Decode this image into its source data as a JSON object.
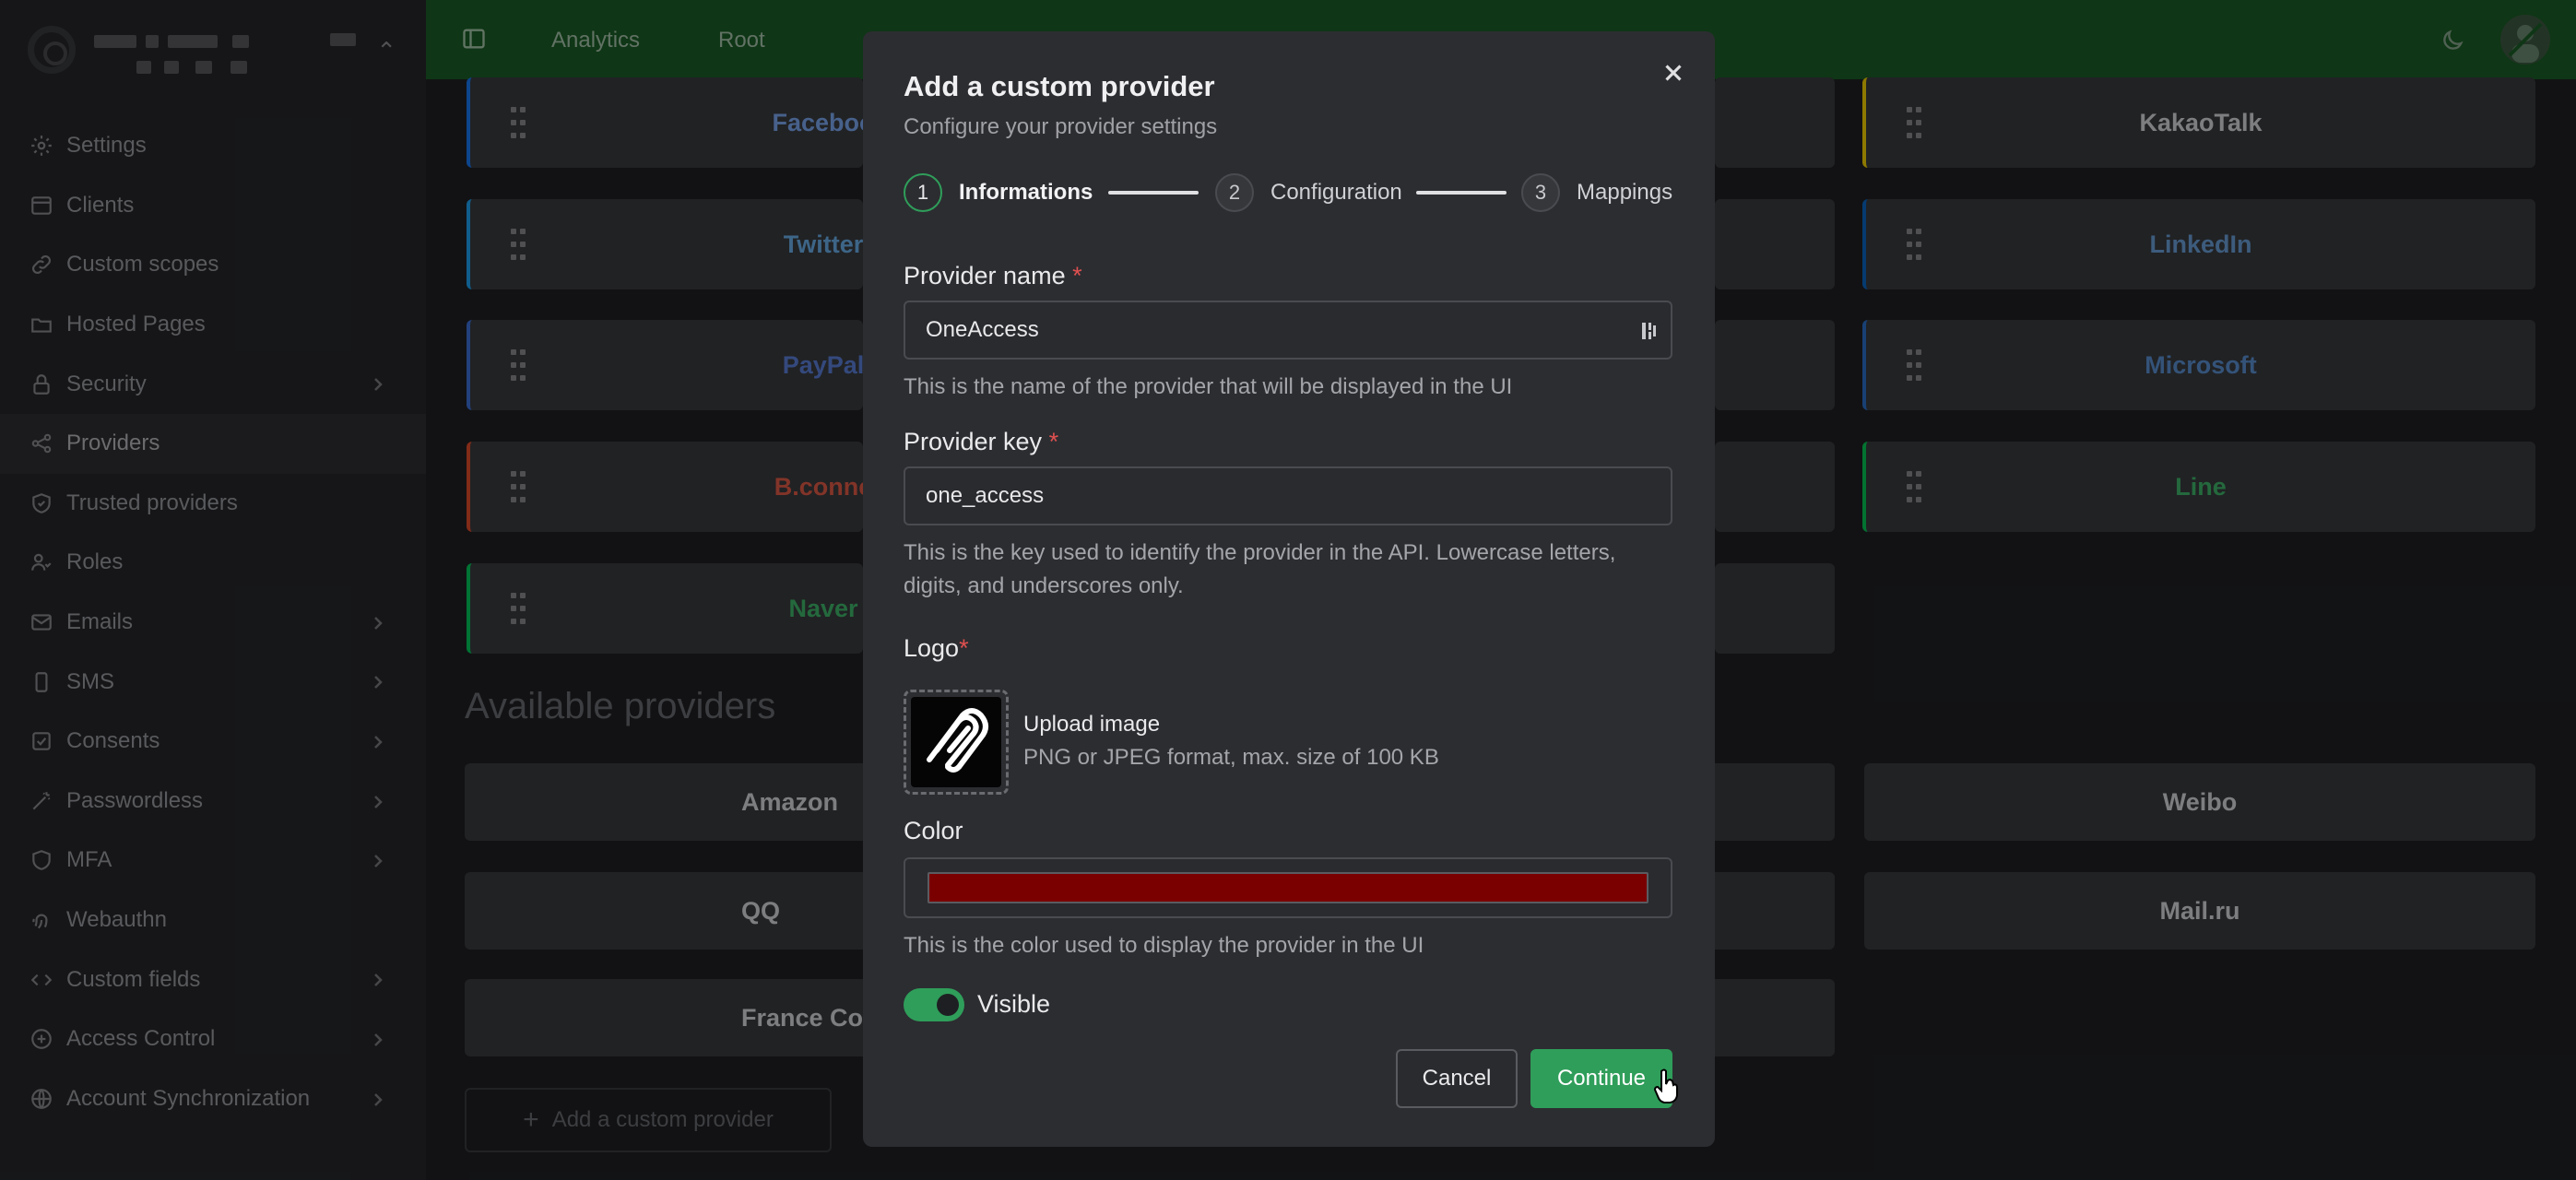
{
  "sidebar": {
    "items": [
      {
        "label": "Settings",
        "icon": "gear-icon",
        "chevron": false
      },
      {
        "label": "Clients",
        "icon": "window-icon",
        "chevron": false
      },
      {
        "label": "Custom scopes",
        "icon": "link-icon",
        "chevron": false
      },
      {
        "label": "Hosted Pages",
        "icon": "folder-icon",
        "chevron": false
      },
      {
        "label": "Security",
        "icon": "lock-icon",
        "chevron": true
      },
      {
        "label": "Providers",
        "icon": "share-icon",
        "chevron": false,
        "active": true
      },
      {
        "label": "Trusted providers",
        "icon": "shield-check-icon",
        "chevron": false
      },
      {
        "label": "Roles",
        "icon": "users-icon",
        "chevron": false
      },
      {
        "label": "Emails",
        "icon": "mail-icon",
        "chevron": true
      },
      {
        "label": "SMS",
        "icon": "phone-icon",
        "chevron": true
      },
      {
        "label": "Consents",
        "icon": "check-square-icon",
        "chevron": true
      },
      {
        "label": "Passwordless",
        "icon": "wand-icon",
        "chevron": true
      },
      {
        "label": "MFA",
        "icon": "shield-icon",
        "chevron": true
      },
      {
        "label": "Webauthn",
        "icon": "fingerprint-icon",
        "chevron": false
      },
      {
        "label": "Custom fields",
        "icon": "code-icon",
        "chevron": true
      },
      {
        "label": "Access Control",
        "icon": "access-icon",
        "chevron": true
      },
      {
        "label": "Account Synchronization",
        "icon": "globe-icon",
        "chevron": true
      }
    ]
  },
  "topbar": {
    "tabs": [
      "Analytics",
      "Root"
    ]
  },
  "providers": {
    "left": [
      {
        "label": "Faceboo",
        "accent": "#1877f2",
        "labelColor": "#7aa7f0"
      },
      {
        "label": "Twitter",
        "accent": "#1da1f2",
        "labelColor": "#6aaee8"
      },
      {
        "label": "PayPal",
        "accent": "#3b6fd6",
        "labelColor": "#5b7fd8"
      },
      {
        "label": "B.conne",
        "accent": "#e04a2a",
        "labelColor": "#e05a45"
      },
      {
        "label": "Naver",
        "accent": "#03c75a",
        "labelColor": "#3fb56a"
      }
    ],
    "right": [
      {
        "label": "KakaoTalk",
        "accent": "#f5d000",
        "labelColor": "#d8d9dc"
      },
      {
        "label": "LinkedIn",
        "accent": "#0a66c2",
        "labelColor": "#6a9fd8"
      },
      {
        "label": "Microsoft",
        "accent": "#2a6fc9",
        "labelColor": "#5a8fd0"
      },
      {
        "label": "Line",
        "accent": "#06c755",
        "labelColor": "#3fb56a"
      }
    ],
    "available_title": "Available providers",
    "available_left": [
      "Amazon",
      "QQ",
      "France Conn"
    ],
    "available_right": [
      "Weibo",
      "Mail.ru"
    ],
    "add_custom_label": "Add a custom provider"
  },
  "modal": {
    "title": "Add a custom provider",
    "subtitle": "Configure your provider settings",
    "steps": [
      {
        "num": "1",
        "label": "Informations"
      },
      {
        "num": "2",
        "label": "Configuration"
      },
      {
        "num": "3",
        "label": "Mappings"
      }
    ],
    "provider_name_label": "Provider name",
    "provider_name_value": "OneAccess",
    "provider_name_help": "This is the name of the provider that will be displayed in the UI",
    "provider_key_label": "Provider key",
    "provider_key_value": "one_access",
    "provider_key_help": "This is the key used to identify the provider in the API. Lowercase letters, digits, and underscores only.",
    "logo_label": "Logo",
    "upload_title": "Upload image",
    "upload_sub": "PNG or JPEG format, max. size of 100 KB",
    "color_label": "Color",
    "color_value": "#7a0000",
    "color_help": "This is the color used to display the provider in the UI",
    "visible_label": "Visible",
    "cancel_label": "Cancel",
    "continue_label": "Continue",
    "required_mark": "*"
  },
  "colors": {
    "accent_green": "#2f9e5a",
    "topbar_green": "#1b5e26"
  }
}
